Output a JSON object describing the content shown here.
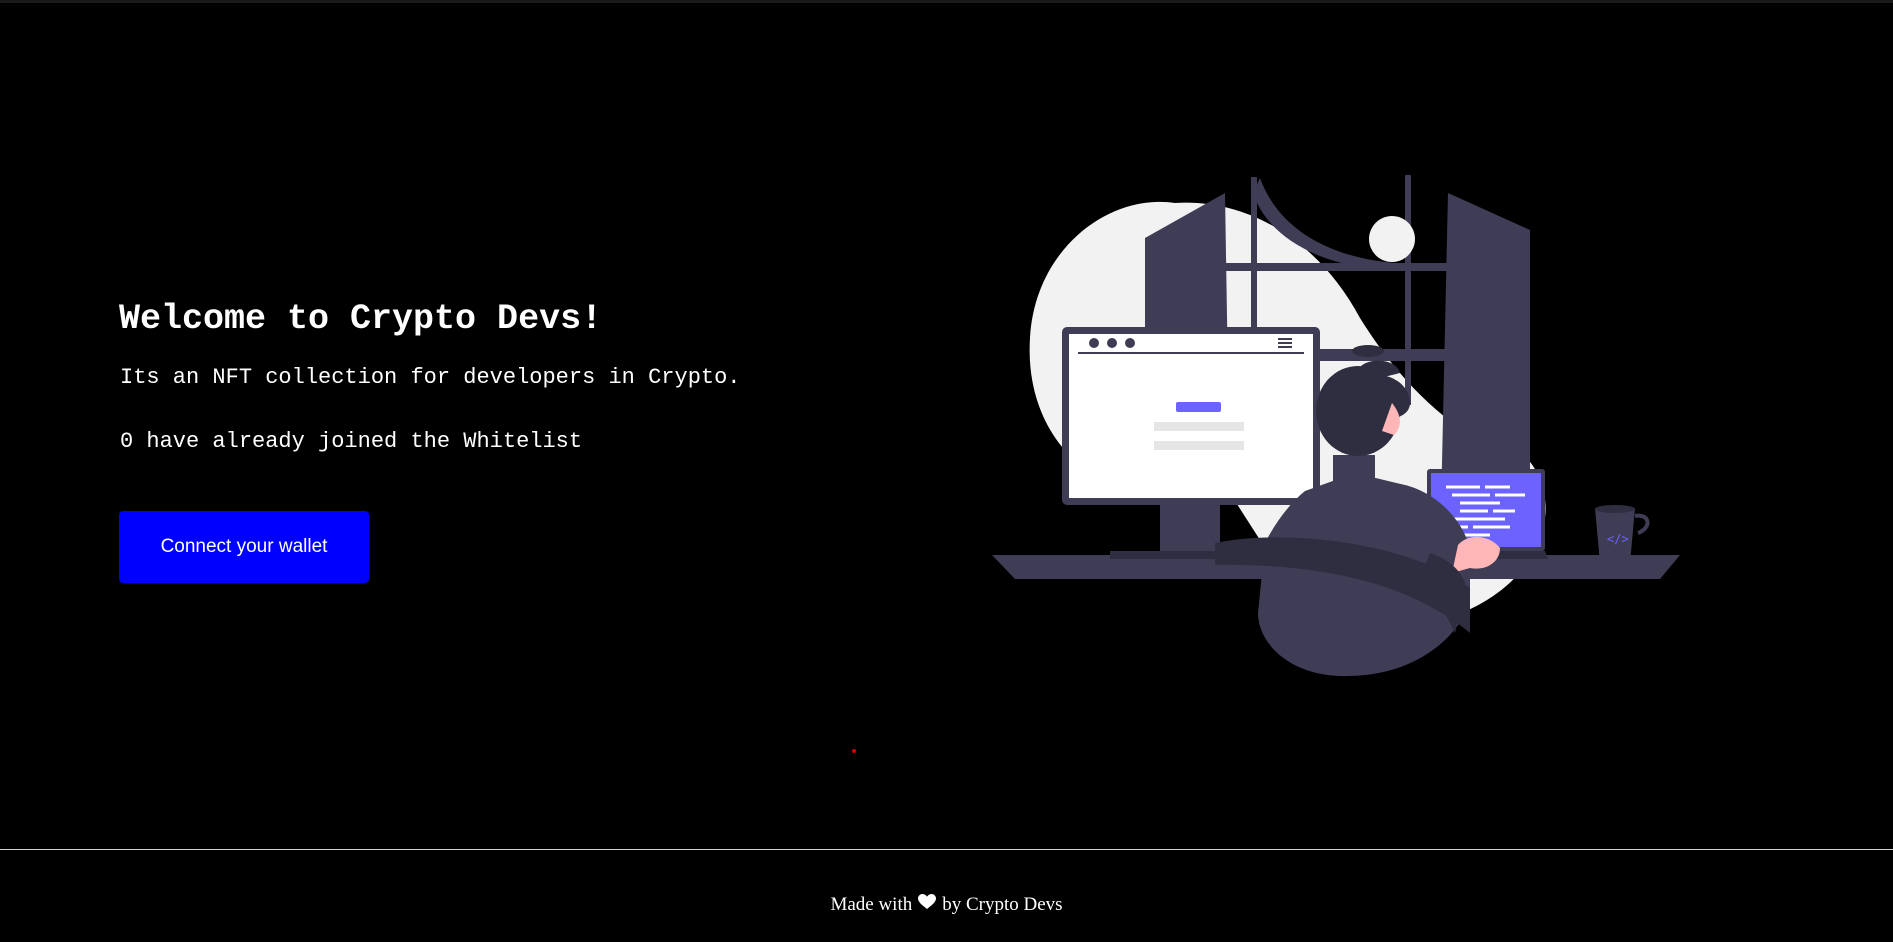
{
  "hero": {
    "title": "Welcome to Crypto Devs!",
    "description": "Its an NFT collection for developers in Crypto.",
    "whitelist_status": "0 have already joined the Whitelist",
    "connect_button_label": "Connect your wallet"
  },
  "footer": {
    "prefix": "Made with",
    "suffix": "by Crypto Devs",
    "icon": "heart-icon"
  },
  "colors": {
    "background": "#000000",
    "button": "#0000ff",
    "accent": "#6c63ff",
    "figure_dark": "#3f3d56",
    "blob": "#f2f2f2"
  }
}
